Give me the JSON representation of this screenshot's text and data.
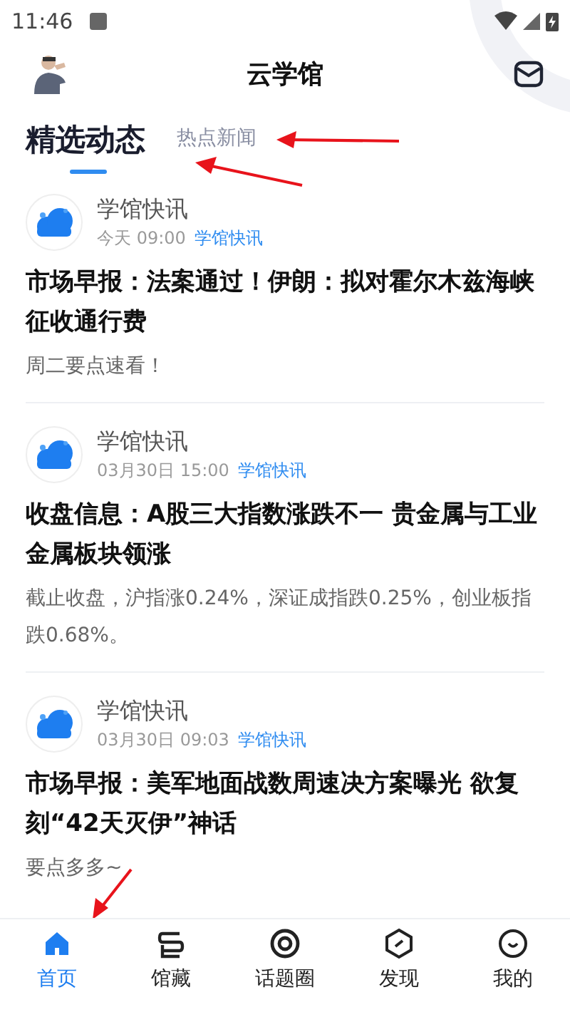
{
  "status_bar": {
    "time": "11:46"
  },
  "header": {
    "title": "云学馆"
  },
  "tabs": [
    {
      "label": "精选动态",
      "selected": true
    },
    {
      "label": "热点新闻",
      "selected": false
    }
  ],
  "posts": [
    {
      "source": "学馆快讯",
      "time": "今天 09:00",
      "tag": "学馆快讯",
      "title": "市场早报：法案通过！伊朗：拟对霍尔木兹海峡征收通行费",
      "summary": "周二要点速看！"
    },
    {
      "source": "学馆快讯",
      "time": "03月30日 15:00",
      "tag": "学馆快讯",
      "title": "收盘信息：A股三大指数涨跌不一 贵金属与工业金属板块领涨",
      "summary": "截止收盘，沪指涨0.24%，深证成指跌0.25%，创业板指跌0.68%。"
    },
    {
      "source": "学馆快讯",
      "time": "03月30日 09:03",
      "tag": "学馆快讯",
      "title": "市场早报：美军地面战数周速决方案曝光 欲复刻“42天灭伊”神话",
      "summary": "要点多多~"
    }
  ],
  "bottom_nav": [
    {
      "kind": "home",
      "label": "首页",
      "selected": true
    },
    {
      "kind": "collection",
      "label": "馆藏",
      "selected": false
    },
    {
      "kind": "topics",
      "label": "话题圈",
      "selected": false
    },
    {
      "kind": "discover",
      "label": "发现",
      "selected": false
    },
    {
      "kind": "me",
      "label": "我的",
      "selected": false
    }
  ]
}
